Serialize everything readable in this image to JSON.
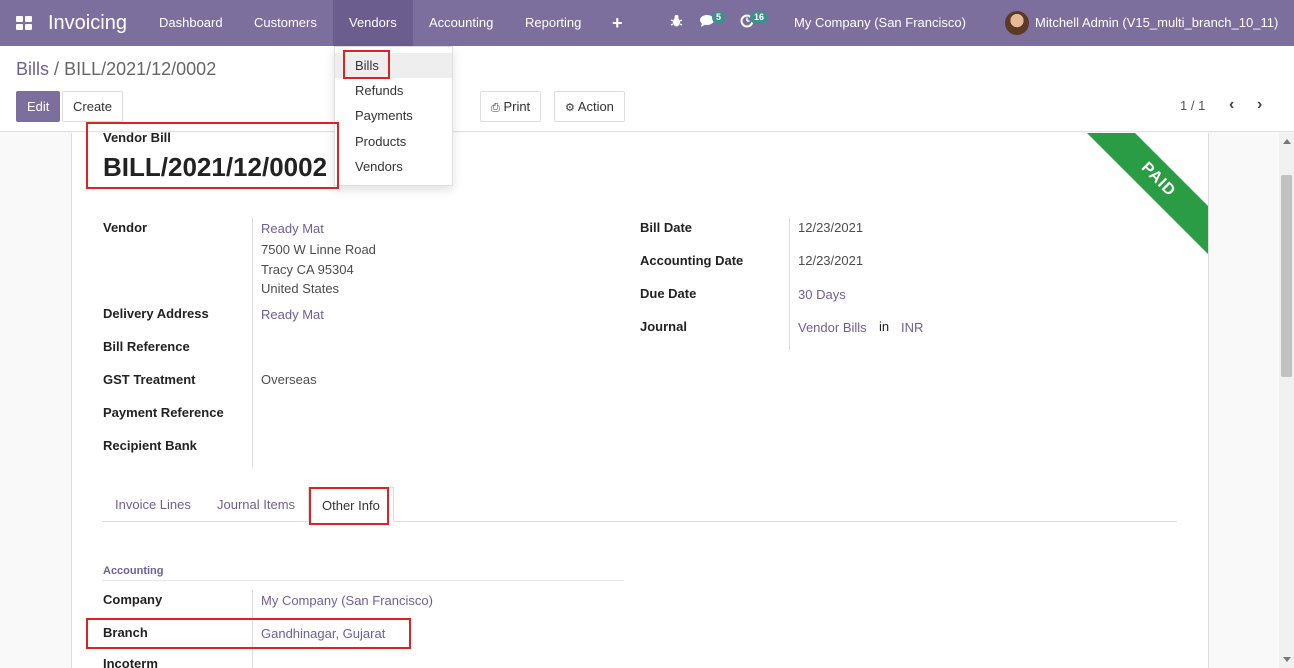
{
  "navbar": {
    "app_name": "Invoicing",
    "menu": [
      "Dashboard",
      "Customers",
      "Vendors",
      "Accounting",
      "Reporting"
    ],
    "plus": "+",
    "messages_count": "5",
    "activities_count": "16",
    "company": "My Company (San Francisco)",
    "user": "Mitchell Admin (V15_multi_branch_10_11)"
  },
  "vendors_menu": [
    "Bills",
    "Refunds",
    "Payments",
    "Products",
    "Vendors"
  ],
  "breadcrumb": {
    "parent": "Bills",
    "separator": "/",
    "current": "BILL/2021/12/0002"
  },
  "buttons": {
    "edit": "Edit",
    "create": "Create",
    "print": "Print",
    "action": "Action"
  },
  "pager": {
    "text": "1 / 1"
  },
  "form": {
    "doc_type": "Vendor Bill",
    "name": "BILL/2021/12/0002",
    "status_ribbon": "PAID",
    "left": {
      "vendor_label": "Vendor",
      "vendor_name": "Ready Mat",
      "vendor_street": "7500 W Linne Road",
      "vendor_city": "Tracy CA 95304",
      "vendor_country": "United States",
      "delivery_label": "Delivery Address",
      "delivery_value": "Ready Mat",
      "bill_ref_label": "Bill Reference",
      "gst_label": "GST Treatment",
      "gst_value": "Overseas",
      "payment_ref_label": "Payment Reference",
      "recipient_bank_label": "Recipient Bank"
    },
    "right": {
      "bill_date_label": "Bill Date",
      "bill_date": "12/23/2021",
      "accounting_date_label": "Accounting Date",
      "accounting_date": "12/23/2021",
      "due_date_label": "Due Date",
      "due_date": "30 Days",
      "journal_label": "Journal",
      "journal": "Vendor Bills",
      "journal_in": "in",
      "currency": "INR"
    },
    "tabs": [
      "Invoice Lines",
      "Journal Items",
      "Other Info"
    ],
    "other_info": {
      "section": "Accounting",
      "company_label": "Company",
      "company_value": "My Company (San Francisco)",
      "branch_label": "Branch",
      "branch_value": "Gandhinagar, Gujarat",
      "incoterm_label": "Incoterm"
    }
  },
  "colors": {
    "navbar": "#7c6f9e",
    "link": "#6f5f97",
    "paid": "#2a9d44",
    "highlight": "#dd2222"
  }
}
